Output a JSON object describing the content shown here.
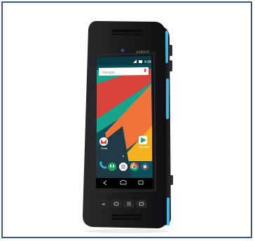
{
  "image": {
    "description_kind": "product-photo",
    "subject": "rugged-android-handheld"
  },
  "device": {
    "brand_label": "unitech",
    "screen": {
      "status_time": "4:38",
      "search_placeholder": "Google",
      "app_labels": {
        "gmail": "Gmail",
        "play_store": "Play Store"
      }
    },
    "colors": {
      "body": "#1a1a1c",
      "accent": "#39b8e6",
      "screen_bg_teal": "#0a9f8c",
      "screen_red": "#d7423a",
      "screen_orange": "#f0743a",
      "screen_yellow": "#f4b120",
      "screen_dark": "#1f3a45"
    },
    "icons": [
      "gmail-icon",
      "play-store-icon",
      "phone-icon",
      "hangouts-icon",
      "app-drawer-icon",
      "chrome-icon",
      "camera-icon",
      "back-nav-icon",
      "home-nav-icon",
      "recents-nav-icon"
    ]
  }
}
